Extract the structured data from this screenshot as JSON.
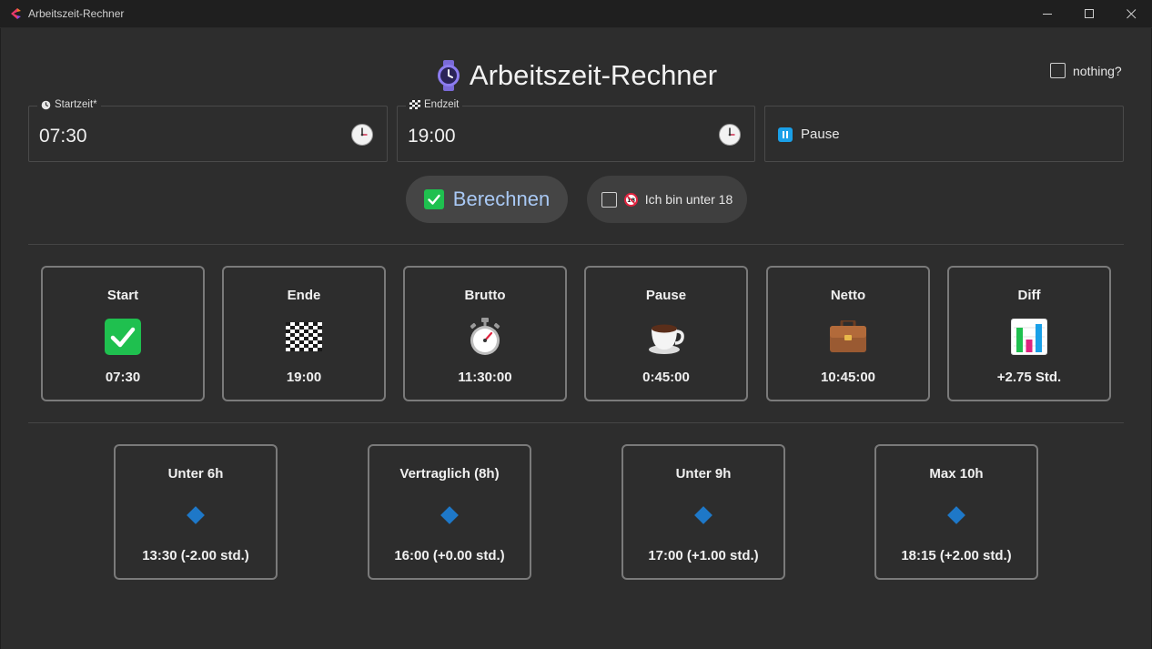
{
  "window": {
    "title": "Arbeitszeit-Rechner"
  },
  "header": {
    "title": "Arbeitszeit-Rechner",
    "icon": "watch-icon"
  },
  "options": {
    "nothing_label": "nothing?",
    "nothing_checked": false
  },
  "inputs": {
    "start": {
      "label": "Startzeit*",
      "value": "07:30"
    },
    "end": {
      "label": "Endzeit",
      "value": "19:00"
    },
    "pause": {
      "label": "Pause"
    }
  },
  "actions": {
    "calculate_label": "Berechnen",
    "under18_label": "Ich bin unter 18",
    "under18_checked": false
  },
  "results": [
    {
      "title": "Start",
      "value": "07:30",
      "icon": "check-icon"
    },
    {
      "title": "Ende",
      "value": "19:00",
      "icon": "checkered-flag-icon"
    },
    {
      "title": "Brutto",
      "value": "11:30:00",
      "icon": "stopwatch-icon"
    },
    {
      "title": "Pause",
      "value": "0:45:00",
      "icon": "coffee-icon"
    },
    {
      "title": "Netto",
      "value": "10:45:00",
      "icon": "briefcase-icon"
    },
    {
      "title": "Diff",
      "value": "+2.75 Std.",
      "icon": "bar-chart-icon"
    }
  ],
  "targets": [
    {
      "title": "Unter 6h",
      "value": "13:30 (-2.00 std.)",
      "icon": "diamond-icon"
    },
    {
      "title": "Vertraglich (8h)",
      "value": "16:00 (+0.00 std.)",
      "icon": "diamond-icon"
    },
    {
      "title": "Unter 9h",
      "value": "17:00 (+1.00 std.)",
      "icon": "diamond-icon"
    },
    {
      "title": "Max 10h",
      "value": "18:15 (+2.00 std.)",
      "icon": "diamond-icon"
    }
  ],
  "colors": {
    "accent_green": "#1fc04f",
    "accent_blue": "#1e78c8",
    "button_text": "#a9c9f5",
    "background": "#2d2d2d"
  }
}
